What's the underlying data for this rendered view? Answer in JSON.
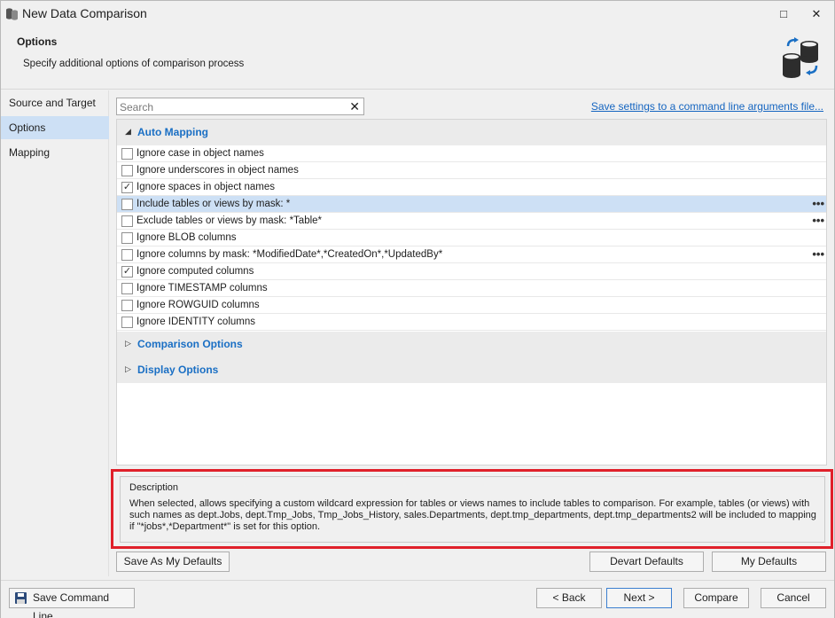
{
  "window": {
    "title": "New Data Comparison",
    "maximize_glyph": "□",
    "close_glyph": "✕"
  },
  "header": {
    "title": "Options",
    "subtitle": "Specify additional options of comparison process"
  },
  "sidebar": {
    "items": [
      {
        "label": "Source and Target",
        "active": false
      },
      {
        "label": "Options",
        "active": true
      },
      {
        "label": "Mapping",
        "active": false
      }
    ]
  },
  "search": {
    "placeholder": "Search",
    "clear_glyph": "✕"
  },
  "save_settings_link": "Save settings to a command line arguments file...",
  "groups": [
    {
      "label": "Auto Mapping",
      "expanded": true
    },
    {
      "label": "Comparison Options",
      "expanded": false
    },
    {
      "label": "Display Options",
      "expanded": false
    }
  ],
  "options": [
    {
      "label": "Ignore case in object names",
      "checked": false,
      "has_more": false
    },
    {
      "label": "Ignore underscores in object names",
      "checked": false,
      "has_more": false
    },
    {
      "label": "Ignore spaces in object names",
      "checked": true,
      "has_more": false
    },
    {
      "label": "Include tables or views by mask: *",
      "checked": false,
      "has_more": true,
      "selected": true
    },
    {
      "label": "Exclude tables or views by mask: *Table*",
      "checked": false,
      "has_more": true
    },
    {
      "label": "Ignore BLOB columns",
      "checked": false,
      "has_more": false
    },
    {
      "label": "Ignore columns by mask: *ModifiedDate*,*CreatedOn*,*UpdatedBy*",
      "checked": false,
      "has_more": true
    },
    {
      "label": "Ignore computed columns",
      "checked": true,
      "has_more": false
    },
    {
      "label": "Ignore TIMESTAMP columns",
      "checked": false,
      "has_more": false
    },
    {
      "label": "Ignore ROWGUID columns",
      "checked": false,
      "has_more": false
    },
    {
      "label": "Ignore IDENTITY columns",
      "checked": false,
      "has_more": false
    }
  ],
  "check_glyph": "✓",
  "more_glyph": "•••",
  "collapsed_glyph": "▷",
  "expanded_glyph": "◢",
  "description": {
    "title": "Description",
    "text": "When selected, allows specifying a custom wildcard expression for tables or views names to include tables to comparison. For example, tables (or views) with such names as dept.Jobs, dept.Tmp_Jobs, Tmp_Jobs_History, sales.Departments, dept.tmp_departments, dept.tmp_departments2 will be included to mapping if \"*jobs*,*Department*\" is set for this option."
  },
  "buttons": {
    "save_as_my_defaults": "Save As My Defaults",
    "devart_defaults": "Devart Defaults",
    "my_defaults": "My Defaults",
    "save_command_line": "Save Command Line...",
    "back": "< Back",
    "next": "Next >",
    "compare": "Compare",
    "cancel": "Cancel"
  },
  "icons": {
    "app": "database-compare-icon",
    "header": "databases-sync-icon",
    "save_command_line": "floppy-disk-icon"
  },
  "colors": {
    "accent": "#1a6fc4",
    "selection": "#cde0f5",
    "highlight_border": "#e0202a"
  }
}
